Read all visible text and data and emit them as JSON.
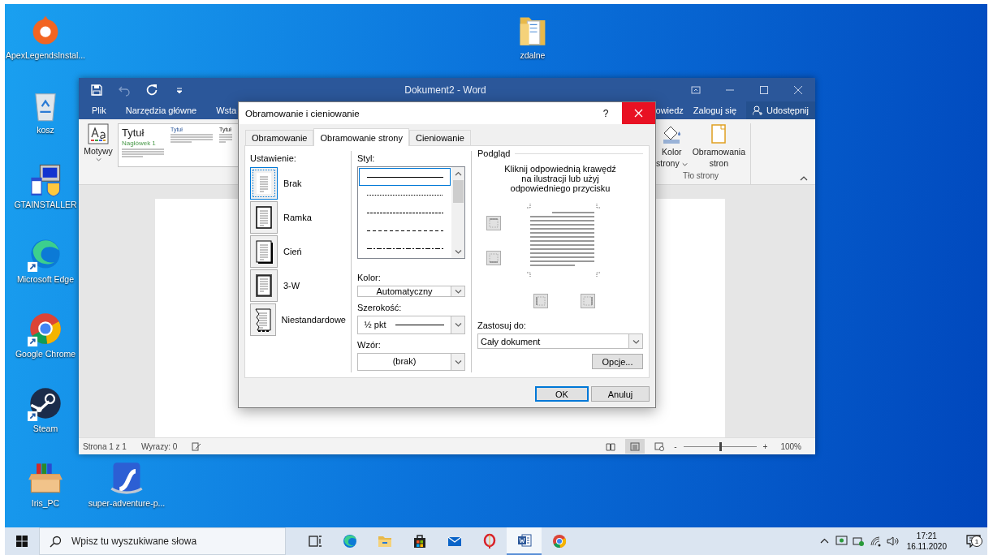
{
  "desktop": {
    "icons": [
      {
        "kind": "origin",
        "label": "ApexLegendsInstal..."
      },
      {
        "kind": "recycle",
        "label": "kosz"
      },
      {
        "kind": "installer",
        "label": "GTAINSTALLER"
      },
      {
        "kind": "edge",
        "label": "Microsoft Edge"
      },
      {
        "kind": "chrome",
        "label": "Google Chrome"
      },
      {
        "kind": "steam",
        "label": "Steam"
      },
      {
        "kind": "box",
        "label": "Iris_PC"
      },
      {
        "kind": "flash",
        "label": "super-adventure-p..."
      },
      {
        "kind": "folder",
        "label": "zdalne"
      }
    ]
  },
  "word": {
    "title": "Dokument2 - Word",
    "tabs": [
      {
        "label": "Plik"
      },
      {
        "label": "Narzędzia główne"
      },
      {
        "label": "Wsta"
      }
    ],
    "tell_me": "owiedz",
    "sign_in": "Zaloguj się",
    "share": "Udostępnij",
    "ribbon": {
      "themes": "Motywy",
      "styles": [
        {
          "title": "Tytuł",
          "heading": "Nagłówek 1"
        },
        {
          "title": "Tytuł"
        },
        {
          "title": "Tytuł"
        }
      ],
      "page_color": [
        "Kolor",
        "strony"
      ],
      "page_borders": [
        "Obramowania",
        "stron"
      ],
      "group": "Tło strony"
    },
    "status_bar": {
      "page": "Strona 1 z 1",
      "words": "Wyrazy: 0",
      "views": [
        {
          "kind": "read",
          "selected": false
        },
        {
          "kind": "print",
          "selected": true
        },
        {
          "kind": "web",
          "selected": false
        }
      ],
      "zoom_out": "-",
      "zoom_in": "+",
      "zoom": {
        "level": 0.5
      },
      "zoom_reading": "100%"
    }
  },
  "dialog": {
    "title": "Obramowanie i cieniowanie",
    "help": "?",
    "tabs": [
      {
        "label": "Obramowanie",
        "selected": false
      },
      {
        "label": "Obramowanie strony",
        "selected": true
      },
      {
        "label": "Cieniowanie",
        "selected": false
      }
    ],
    "setting_label": "Ustawienie:",
    "settings": [
      {
        "kind": "none",
        "label": "Brak",
        "selected": true
      },
      {
        "kind": "box",
        "label": "Ramka",
        "selected": false
      },
      {
        "kind": "shadow",
        "label": "Cień",
        "selected": false
      },
      {
        "kind": "threed",
        "label": "3-W",
        "selected": false
      },
      {
        "kind": "custom",
        "label": "Niestandardowe",
        "selected": false
      }
    ],
    "style_label": "Styl:",
    "styles": [
      {
        "kind": "solid",
        "selected": true
      },
      {
        "kind": "dotted",
        "selected": false
      },
      {
        "kind": "fine-dashed",
        "selected": false
      },
      {
        "kind": "dashed",
        "selected": false
      },
      {
        "kind": "dash-dot",
        "selected": false
      }
    ],
    "color_label": "Kolor:",
    "line_color_setting": "Automatyczny",
    "width_label": "Szerokość:",
    "width": "½ pkt",
    "art_label": "Wzór:",
    "art": "(brak)",
    "preview_label": "Podgląd",
    "preview_hint": "Kliknij odpowiednią krawędź na ilustracji lub użyj odpowiedniego przycisku",
    "apply_label": "Zastosuj do:",
    "apply_to": "Cały dokument",
    "options": "Opcje...",
    "ok": "OK",
    "cancel": "Anuluj"
  },
  "taskbar": {
    "search_placeholder": "Wpisz tu wyszukiwane słowa",
    "apps": [
      {
        "kind": "taskview",
        "selected": false
      },
      {
        "kind": "edge",
        "selected": false
      },
      {
        "kind": "explorer",
        "selected": false
      },
      {
        "kind": "store",
        "selected": false
      },
      {
        "kind": "mail",
        "selected": false
      },
      {
        "kind": "opera",
        "selected": false
      },
      {
        "kind": "word",
        "selected": true
      },
      {
        "kind": "chrome",
        "selected": false
      }
    ],
    "time": "17:21",
    "date": "16.11.2020",
    "notification_count": "1"
  }
}
